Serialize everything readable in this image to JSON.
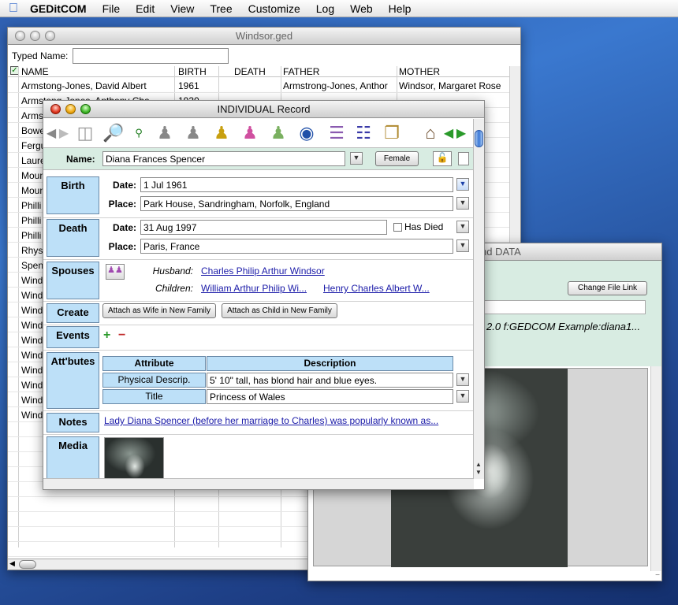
{
  "menubar": {
    "app": "GEDitCOM",
    "items": [
      "File",
      "Edit",
      "View",
      "Tree",
      "Customize",
      "Log",
      "Web",
      "Help"
    ]
  },
  "windsor": {
    "title": "Windsor.ged",
    "typed_name_label": "Typed Name:",
    "columns": {
      "name": "NAME",
      "birth": "BIRTH",
      "death": "DEATH",
      "father": "FATHER",
      "mother": "MOTHER"
    },
    "rows": [
      {
        "name": "Armstong-Jones, David Albert",
        "birth": "1961",
        "death": "",
        "father": "Armstrong-Jones, Anthor",
        "mother": "Windsor, Margaret Rose"
      },
      {
        "name": "Armstong-Jones, Anthony Cha",
        "birth": "1930",
        "death": "",
        "father": "",
        "mother": ""
      },
      {
        "name": "Arms",
        "birth": "",
        "death": "",
        "father": "",
        "mother": ""
      },
      {
        "name": "Bowe",
        "birth": "",
        "death": "",
        "father": "",
        "mother": ""
      },
      {
        "name": "Fergu",
        "birth": "",
        "death": "",
        "father": "",
        "mother": ""
      },
      {
        "name": "Laure",
        "birth": "",
        "death": "",
        "father": "",
        "mother": ""
      },
      {
        "name": "Moun",
        "birth": "",
        "death": "",
        "father": "",
        "mother": ""
      },
      {
        "name": "Moun",
        "birth": "",
        "death": "",
        "father": "",
        "mother": "e"
      },
      {
        "name": "Philli",
        "birth": "",
        "death": "",
        "father": "",
        "mother": ""
      },
      {
        "name": "Philli",
        "birth": "",
        "death": "",
        "father": "",
        "mother": "abeth"
      },
      {
        "name": "Philli",
        "birth": "",
        "death": "",
        "father": "",
        "mother": "abeth"
      },
      {
        "name": "Rhys",
        "birth": "",
        "death": "",
        "father": "",
        "mother": ""
      },
      {
        "name": "Spen",
        "birth": "",
        "death": "",
        "father": "",
        "mother": ""
      },
      {
        "name": "Wind",
        "birth": "",
        "death": "",
        "father": "",
        "mother": ""
      },
      {
        "name": "Wind",
        "birth": "",
        "death": "",
        "father": "",
        "mother": ""
      },
      {
        "name": "Wind",
        "birth": "",
        "death": "",
        "father": "",
        "mother": ""
      },
      {
        "name": "Wind",
        "birth": "",
        "death": "",
        "father": "",
        "mother": ""
      },
      {
        "name": "Wind",
        "birth": "",
        "death": "",
        "father": "",
        "mother": ""
      },
      {
        "name": "Wind",
        "birth": "",
        "death": "",
        "father": "",
        "mother": ""
      },
      {
        "name": "Wind",
        "birth": "",
        "death": "",
        "father": "",
        "mother": ""
      },
      {
        "name": "Wind",
        "birth": "",
        "death": "",
        "father": "",
        "mother": ""
      },
      {
        "name": "Wind",
        "birth": "",
        "death": "",
        "father": "",
        "mother": ""
      },
      {
        "name": "Wind",
        "birth": "",
        "death": "",
        "father": "",
        "mother": ""
      },
      {
        "name": "",
        "birth": "",
        "death": "",
        "father": "",
        "mother": ""
      },
      {
        "name": "",
        "birth": "",
        "death": "",
        "father": "",
        "mother": ""
      },
      {
        "name": "",
        "birth": "",
        "death": "",
        "father": "",
        "mother": ""
      },
      {
        "name": "",
        "birth": "",
        "death": "",
        "father": "",
        "mother": ""
      },
      {
        "name": "",
        "birth": "",
        "death": "",
        "father": "",
        "mother": ""
      },
      {
        "name": "",
        "birth": "",
        "death": "",
        "father": "",
        "mother": ""
      },
      {
        "name": "",
        "birth": "",
        "death": "",
        "father": "",
        "mother": ""
      },
      {
        "name": "",
        "birth": "",
        "death": "",
        "father": "",
        "mother": ""
      },
      {
        "name": "",
        "birth": "",
        "death": "",
        "father": "",
        "mother": ""
      }
    ]
  },
  "data_window": {
    "title": "nd DATA",
    "change_link": "Change File Link",
    "meta": "2.0 f:GEDCOM Example:diana1..."
  },
  "record": {
    "title": "INDIVIDUAL Record",
    "name_label": "Name:",
    "name_value": "Diana Frances Spencer",
    "sex_button": "Female",
    "birth": {
      "section": "Birth",
      "date_label": "Date:",
      "date": "1 Jul 1961",
      "place_label": "Place:",
      "place": "Park House, Sandringham, Norfolk, England"
    },
    "death": {
      "section": "Death",
      "date_label": "Date:",
      "date": "31 Aug 1997",
      "has_died": "Has Died",
      "place_label": "Place:",
      "place": "Paris, France"
    },
    "spouses": {
      "section": "Spouses",
      "husband_label": "Husband:",
      "husband": "Charles Philip Arthur Windsor",
      "children_label": "Children:",
      "child1": "William Arthur Philip Wi...",
      "child2": "Henry Charles Albert W..."
    },
    "create": {
      "section": "Create",
      "wife_btn": "Attach as Wife in New Family",
      "child_btn": "Attach as Child in New Family"
    },
    "events": {
      "section": "Events"
    },
    "attributes": {
      "section": "Att'butes",
      "col_attr": "Attribute",
      "col_desc": "Description",
      "rows": [
        {
          "attr": "Physical Descrip.",
          "desc": "5' 10\" tall, has blond hair and blue eyes."
        },
        {
          "attr": "Title",
          "desc": "Princess of Wales"
        }
      ]
    },
    "notes": {
      "section": "Notes",
      "text": "Lady Diana Spencer (before her marriage to Charles) was popularly known as..."
    },
    "media": {
      "section": "Media"
    }
  },
  "icons": {
    "back": "back-arrow-icon",
    "forward": "forward-arrow-icon",
    "home": "home-icon"
  }
}
